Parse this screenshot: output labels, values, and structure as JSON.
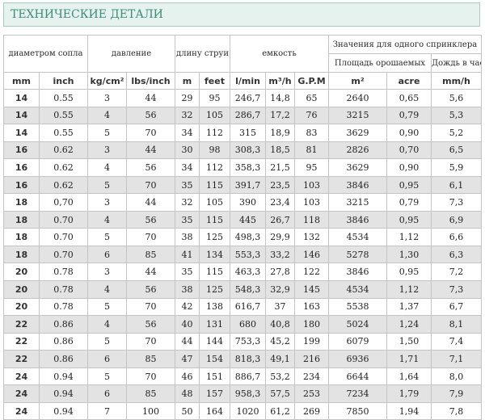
{
  "page": {
    "title": "ТЕХНИЧЕСКИЕ ДЕТАЛИ"
  },
  "headers": {
    "nozzle": "диаметром сопла",
    "pressure": "давление",
    "throw": "длину струи",
    "capacity": "емкость",
    "sprinkler_group": "Значения для одного спринклера",
    "area": "Площадь орошаемых",
    "rain": "Дождь в час"
  },
  "units": [
    "mm",
    "inch",
    "kg/cm²",
    "lbs/inch",
    "m",
    "feet",
    "l/min",
    "m³/h",
    "G.P.M",
    "m²",
    "acre",
    "mm/h"
  ],
  "rows": [
    [
      "14",
      "0.55",
      "3",
      "44",
      "29",
      "95",
      "246,7",
      "14,8",
      "65",
      "2640",
      "0,65",
      "5,6"
    ],
    [
      "14",
      "0.55",
      "4",
      "56",
      "32",
      "105",
      "286,7",
      "17,2",
      "76",
      "3215",
      "0,79",
      "5,3"
    ],
    [
      "14",
      "0.55",
      "5",
      "70",
      "34",
      "112",
      "315",
      "18,9",
      "83",
      "3629",
      "0,90",
      "5,2"
    ],
    [
      "16",
      "0.62",
      "3",
      "44",
      "30",
      "98",
      "308,3",
      "18,5",
      "81",
      "2826",
      "0,70",
      "6,5"
    ],
    [
      "16",
      "0.62",
      "4",
      "56",
      "34",
      "112",
      "358,3",
      "21,5",
      "95",
      "3629",
      "0,90",
      "5,9"
    ],
    [
      "16",
      "0.62",
      "5",
      "70",
      "35",
      "115",
      "391,7",
      "23,5",
      "103",
      "3846",
      "0,95",
      "6,1"
    ],
    [
      "18",
      "0,70",
      "3",
      "44",
      "32",
      "105",
      "390",
      "23,4",
      "103",
      "3215",
      "0,79",
      "7,3"
    ],
    [
      "18",
      "0.70",
      "4",
      "56",
      "35",
      "115",
      "445",
      "26,7",
      "118",
      "3846",
      "0,95",
      "6,9"
    ],
    [
      "18",
      "0.70",
      "5",
      "70",
      "38",
      "125",
      "498,3",
      "29,9",
      "132",
      "4534",
      "1,12",
      "6,6"
    ],
    [
      "18",
      "0.70",
      "6",
      "85",
      "41",
      "134",
      "553,3",
      "33,2",
      "146",
      "5278",
      "1,30",
      "6,3"
    ],
    [
      "20",
      "0.78",
      "3",
      "44",
      "35",
      "115",
      "463,3",
      "27,8",
      "122",
      "3846",
      "0,95",
      "7,2"
    ],
    [
      "20",
      "0.78",
      "4",
      "56",
      "38",
      "125",
      "548,3",
      "32,9",
      "145",
      "4534",
      "1,12",
      "7,3"
    ],
    [
      "20",
      "0.78",
      "5",
      "70",
      "42",
      "138",
      "616,7",
      "37",
      "163",
      "5538",
      "1,37",
      "6,7"
    ],
    [
      "22",
      "0.86",
      "4",
      "56",
      "40",
      "131",
      "680",
      "40,8",
      "180",
      "5024",
      "1,24",
      "8,1"
    ],
    [
      "22",
      "0.86",
      "5",
      "70",
      "44",
      "144",
      "753,3",
      "45,2",
      "199",
      "6079",
      "1,50",
      "7,4"
    ],
    [
      "22",
      "0.86",
      "6",
      "85",
      "47",
      "154",
      "818,3",
      "49,1",
      "216",
      "6936",
      "1,71",
      "7,1"
    ],
    [
      "24",
      "0.94",
      "5",
      "70",
      "46",
      "151",
      "886,7",
      "53,2",
      "234",
      "6644",
      "1,64",
      "8,0"
    ],
    [
      "24",
      "0.94",
      "6",
      "85",
      "48",
      "157",
      "958,3",
      "57,5",
      "253",
      "7234",
      "1,79",
      "7,9"
    ],
    [
      "24",
      "0.94",
      "7",
      "100",
      "50",
      "164",
      "1020",
      "61,2",
      "269",
      "7850",
      "1,94",
      "7,8"
    ]
  ]
}
